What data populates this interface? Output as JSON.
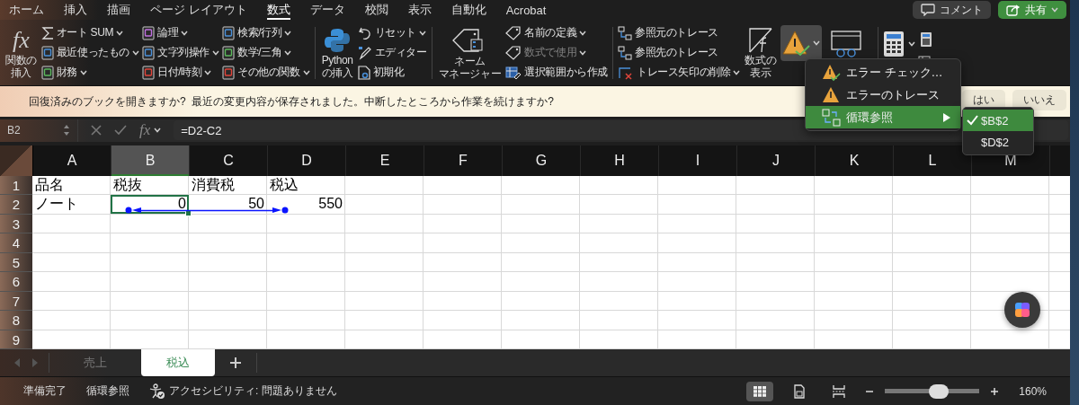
{
  "tabs": [
    {
      "label": "ホーム",
      "selected": false
    },
    {
      "label": "挿入",
      "selected": false
    },
    {
      "label": "描画",
      "selected": false
    },
    {
      "label": "ページ レイアウト",
      "selected": false
    },
    {
      "label": "数式",
      "selected": true
    },
    {
      "label": "データ",
      "selected": false
    },
    {
      "label": "校閲",
      "selected": false
    },
    {
      "label": "表示",
      "selected": false
    },
    {
      "label": "自動化",
      "selected": false
    },
    {
      "label": "Acrobat",
      "selected": false
    }
  ],
  "header_buttons": {
    "comment": "コメント",
    "share": "共有"
  },
  "ribbon": {
    "insert_function": {
      "symbol": "fx",
      "label_lines": [
        "関数の",
        "挿入"
      ]
    },
    "function_library": [
      [
        {
          "label": "オート SUM",
          "dropdown": true
        },
        {
          "label": "最近使ったもの",
          "dropdown": true
        },
        {
          "label": "財務",
          "dropdown": true
        }
      ],
      [
        {
          "label": "論理",
          "dropdown": true
        },
        {
          "label": "文字列操作",
          "dropdown": true
        },
        {
          "label": "日付/時刻",
          "dropdown": true
        }
      ],
      [
        {
          "label": "検索/行列",
          "dropdown": true
        },
        {
          "label": "数学/三角",
          "dropdown": true
        },
        {
          "label": "その他の関数",
          "dropdown": true
        }
      ]
    ],
    "python_insert": {
      "label_lines": [
        "Python",
        "の挿入"
      ]
    },
    "python_tools": [
      {
        "label": "リセット",
        "dropdown": true
      },
      {
        "label": "エディター",
        "dropdown": false
      },
      {
        "label": "初期化",
        "dropdown": false
      }
    ],
    "name_manager": {
      "label_lines": [
        "ネーム",
        "マネージャー"
      ]
    },
    "defined_names": [
      {
        "label": "名前の定義",
        "dropdown": true,
        "disabled": false
      },
      {
        "label": "数式で使用",
        "dropdown": true,
        "disabled": true
      },
      {
        "label": "選択範囲から作成",
        "dropdown": false,
        "disabled": false
      }
    ],
    "auditing": [
      {
        "label": "参照元のトレース",
        "dropdown": false
      },
      {
        "label": "参照先のトレース",
        "dropdown": false
      },
      {
        "label": "トレース矢印の削除",
        "dropdown": true
      }
    ],
    "show_formulas": {
      "label_lines": [
        "数式の",
        "表示"
      ]
    },
    "error_check": {
      "pressed": true
    }
  },
  "message_bar": {
    "text": "回復済みのブックを開きますか?  最近の変更内容が保存されました。中断したところから作業を続けますか?",
    "buttons": [
      "はい",
      "いいえ"
    ]
  },
  "error_menu": [
    {
      "label": "エラー チェック…",
      "selected": false,
      "submenu": false
    },
    {
      "label": "エラーのトレース",
      "selected": false,
      "submenu": false
    },
    {
      "label": "循環参照",
      "selected": true,
      "submenu": true
    }
  ],
  "circular_submenu": [
    {
      "label": "$B$2",
      "selected": true,
      "checked": true
    },
    {
      "label": "$D$2",
      "selected": false,
      "checked": false
    }
  ],
  "formula_bar": {
    "name_box": "B2",
    "symbol": "fx",
    "formula": "=D2-C2"
  },
  "sheet": {
    "columns": [
      {
        "label": "A",
        "selected": false
      },
      {
        "label": "B",
        "selected": true
      },
      {
        "label": "C",
        "selected": false
      },
      {
        "label": "D",
        "selected": false
      },
      {
        "label": "E",
        "selected": false
      },
      {
        "label": "F",
        "selected": false
      },
      {
        "label": "G",
        "selected": false
      },
      {
        "label": "H",
        "selected": false
      },
      {
        "label": "I",
        "selected": false
      },
      {
        "label": "J",
        "selected": false
      },
      {
        "label": "K",
        "selected": false
      },
      {
        "label": "L",
        "selected": false
      },
      {
        "label": "M",
        "selected": false
      }
    ],
    "rows": [
      {
        "label": "1",
        "cells": [
          {
            "text": "品名",
            "kind": "text",
            "selected": false
          },
          {
            "text": "税抜",
            "kind": "text",
            "selected": false
          },
          {
            "text": "消費税",
            "kind": "text",
            "selected": false
          },
          {
            "text": "税込",
            "kind": "text",
            "selected": false
          }
        ]
      },
      {
        "label": "2",
        "cells": [
          {
            "text": "ノート",
            "kind": "text",
            "selected": false
          },
          {
            "text": "0",
            "kind": "number",
            "selected": true
          },
          {
            "text": "50",
            "kind": "number",
            "selected": false
          },
          {
            "text": "550",
            "kind": "number",
            "selected": false
          }
        ]
      },
      {
        "label": "3"
      },
      {
        "label": "4"
      },
      {
        "label": "5"
      },
      {
        "label": "6"
      },
      {
        "label": "7"
      },
      {
        "label": "8"
      },
      {
        "label": "9"
      }
    ],
    "trace_arrow": true
  },
  "sheet_tabs": [
    {
      "label": "売上",
      "selected": false
    },
    {
      "label": "税込",
      "selected": true
    }
  ],
  "status_bar": {
    "ready": "準備完了",
    "circular": "循環参照",
    "accessibility": "アクセシビリティ: 問題ありません",
    "views": [
      {
        "selected": true
      },
      {
        "selected": false
      },
      {
        "selected": false
      }
    ],
    "zoom": {
      "level": 0.57,
      "reading": "160%"
    }
  }
}
